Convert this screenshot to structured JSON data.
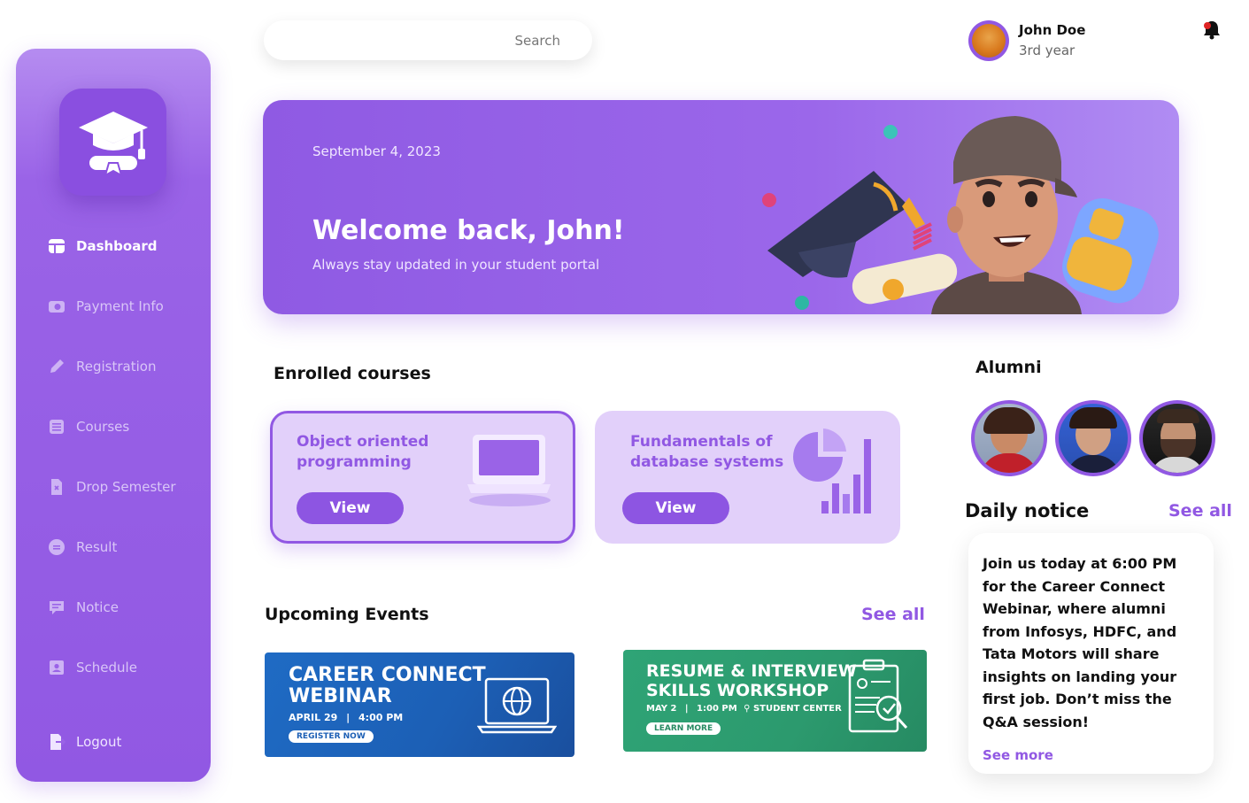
{
  "sidebar": {
    "items": [
      {
        "label": "Dashboard",
        "icon": "dashboard-icon",
        "active": true
      },
      {
        "label": "Payment Info",
        "icon": "payment-icon"
      },
      {
        "label": "Registration",
        "icon": "pencil-icon"
      },
      {
        "label": "Courses",
        "icon": "courses-icon"
      },
      {
        "label": "Drop Semester",
        "icon": "drop-icon"
      },
      {
        "label": "Result",
        "icon": "result-icon"
      },
      {
        "label": "Notice",
        "icon": "notice-icon"
      },
      {
        "label": "Schedule",
        "icon": "schedule-icon"
      }
    ],
    "logout_label": "Logout"
  },
  "search": {
    "placeholder": "Search"
  },
  "user": {
    "name": "John Doe",
    "year": "3rd year"
  },
  "banner": {
    "date": "September 4,  2023",
    "title": "Welcome back, John!",
    "subtitle": "Always stay updated in your student portal"
  },
  "courses": {
    "heading": "Enrolled courses",
    "items": [
      {
        "title": "Object oriented programming",
        "button": "View"
      },
      {
        "title": "Fundamentals of database systems",
        "button": "View"
      }
    ]
  },
  "events": {
    "heading": "Upcoming Events",
    "see_all": "See all",
    "items": [
      {
        "title_line1": "CAREER CONNECT",
        "title_line2": "WEBINAR",
        "date": "APRIL 29",
        "sep": "|",
        "time": "4:00 PM",
        "cta": "REGISTER NOW"
      },
      {
        "title_line1": "RESUME & INTERVIEW",
        "title_line2": "SKILLS WORKSHOP",
        "date": "MAY 2",
        "sep": "|",
        "time": "1:00 PM",
        "location": "STUDENT CENTER",
        "cta": "LEARN MORE"
      }
    ]
  },
  "alumni": {
    "heading": "Alumni"
  },
  "notice": {
    "heading": "Daily notice",
    "see_all": "See all",
    "text": "Join us today at 6:00 PM for the Career Connect Webinar, where alumni from Infosys, HDFC, and Tata Motors will share insights on landing your first job. Don’t miss the Q&A session!",
    "see_more": "See more"
  },
  "colors": {
    "accent": "#9158e3",
    "event1": "#1d62b8",
    "event2": "#2e9a6e"
  }
}
